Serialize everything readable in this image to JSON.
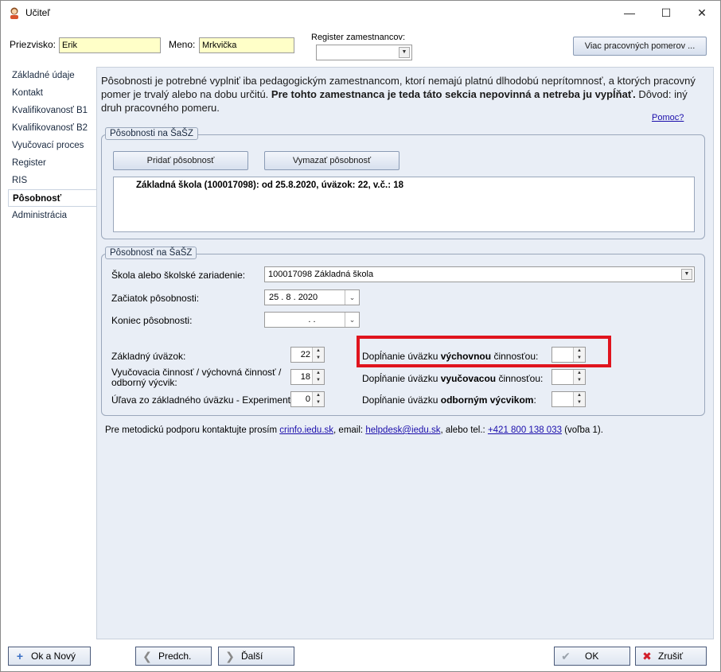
{
  "window": {
    "title": "Učiteľ"
  },
  "header": {
    "surname_label": "Priezvisko:",
    "surname_value": "Erik",
    "name_label": "Meno:",
    "name_value": "Mrkvička",
    "register_label": "Register zamestnancov:",
    "register_value": "",
    "more_button": "Viac pracovných pomerov ..."
  },
  "sidebar": {
    "items": [
      {
        "label": "Základné údaje"
      },
      {
        "label": "Kontakt"
      },
      {
        "label": "Kvalifikovanosť B1"
      },
      {
        "label": "Kvalifikovanosť B2"
      },
      {
        "label": "Vyučovací proces"
      },
      {
        "label": "Register"
      },
      {
        "label": "RIS"
      },
      {
        "label": "Pôsobnosť"
      },
      {
        "label": "Administrácia"
      }
    ],
    "active_index": 7
  },
  "main": {
    "intro_part1": "Pôsobnosti je potrebné vyplniť iba pedagogickým zamestnancom, ktorí nemajú platnú dlhodobú neprítomnosť, a ktorých pracovný pomer je trvalý alebo na dobu určitú.",
    "intro_bold": "Pre tohto zamestnanca je teda táto sekcia nepovinná a netreba ju vypĺňať.",
    "intro_part2": "Dôvod: iný druh pracovného pomeru.",
    "help_link": "Pomoc?",
    "list_group": {
      "legend": "Pôsobnosti na ŠaŠZ",
      "add_button": "Pridať pôsobnosť",
      "delete_button": "Vymazať pôsobnosť",
      "items": [
        "Základná škola (100017098): od 25.8.2020, úväzok: 22, v.č.: 18"
      ]
    },
    "detail_group": {
      "legend": "Pôsobnosť na ŠaŠZ",
      "school_label": "Škola alebo školské zariadenie:",
      "school_value": "100017098 Základná škola",
      "start_label": "Začiatok pôsobnosti:",
      "start_value": "25 .   8 .  2020",
      "end_label": "Koniec pôsobnosti:",
      "end_value": ".        .",
      "basic_load_label": "Základný úväzok:",
      "basic_load_value": "22",
      "teaching_label_line1": "Vyučovacia činnosť / výchovná činnosť /",
      "teaching_label_line2": "odborný výcvik:",
      "teaching_value": "18",
      "relief_label": "Úľava zo základného úväzku - Experiment:",
      "relief_value": "0",
      "fill_prefix": "Dopĺňanie úväzku",
      "fill_suffix": "činnosťou:",
      "fill1_bold": "výchovnou",
      "fill1_value": "",
      "fill2_bold": "vyučovacou",
      "fill2_value": "",
      "fill3_prefix": "Dopĺňanie úväzku",
      "fill3_bold": "odborným výcvikom",
      "fill3_suffix": ":",
      "fill3_value": ""
    },
    "support": {
      "text1": "Pre metodickú podporu kontaktujte prosím",
      "link1": "crinfo.iedu.sk",
      "text2": ", email:",
      "link2": "helpdesk@iedu.sk",
      "text3": ", alebo tel.:",
      "link3": "+421 800 138 033",
      "text4": "(voľba 1)."
    }
  },
  "footer": {
    "ok_new": "Ok a Nový",
    "prev": "Predch.",
    "next": "Ďalší",
    "ok": "OK",
    "cancel": "Zrušiť"
  },
  "colors": {
    "highlight_box": "#e0141e",
    "input_yellow": "#ffffc8",
    "panel_bg": "#e9eef6"
  }
}
